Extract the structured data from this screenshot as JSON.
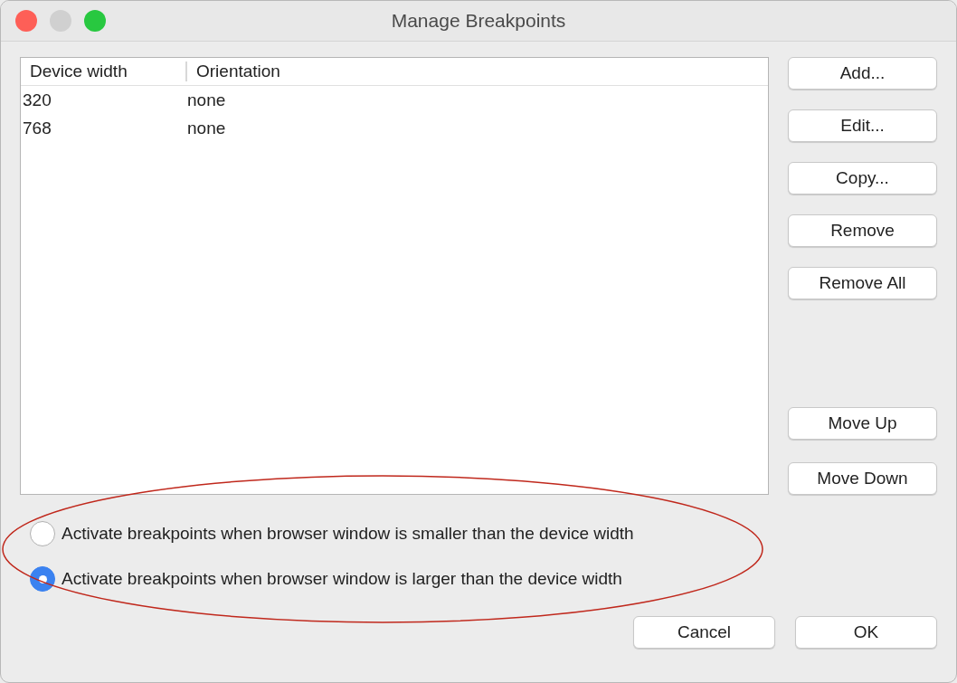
{
  "window": {
    "title": "Manage Breakpoints"
  },
  "title_buttons": [
    {
      "kind": "close",
      "disabled": false
    },
    {
      "kind": "minimize",
      "disabled": true
    },
    {
      "kind": "zoom",
      "disabled": false
    }
  ],
  "table": {
    "columns": [
      "Device width",
      "Orientation"
    ],
    "rows": [
      {
        "cells": [
          "320",
          "none"
        ],
        "selected": false
      },
      {
        "cells": [
          "768",
          "none"
        ],
        "selected": false
      }
    ]
  },
  "side_buttons": {
    "edit_group": [
      "Add...",
      "Edit...",
      "Copy...",
      "Remove",
      "Remove All"
    ],
    "move_group": [
      "Move Up",
      "Move Down"
    ]
  },
  "options": [
    {
      "label": "Activate breakpoints when browser window is smaller than the device width",
      "selected": false
    },
    {
      "label": "Activate breakpoints when browser window is larger than the device width",
      "selected": true
    }
  ],
  "footer_buttons": [
    "Cancel",
    "OK"
  ]
}
